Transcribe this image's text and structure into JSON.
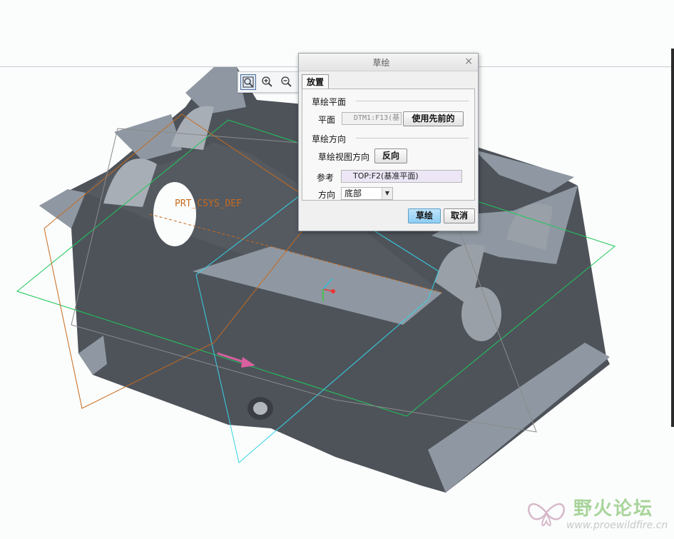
{
  "viewport": {
    "csys_label": "PRT_CSYS_DEF",
    "colors": {
      "part": "#4e535a",
      "part_top": "#8f98a2",
      "datum_green": "#1ec85a",
      "datum_cyan": "#35d3e6",
      "datum_orange": "#c76a1c",
      "arrow": "#d9609f"
    }
  },
  "view_toolbar": {
    "buttons": [
      {
        "icon": "refit-icon"
      },
      {
        "icon": "zoom-in-icon"
      },
      {
        "icon": "zoom-out-icon"
      }
    ]
  },
  "dialog": {
    "title": "草绘",
    "close_glyph": "×",
    "tab_label": "放置",
    "plane_section": "草绘平面",
    "plane_label": "平面",
    "plane_value": "DTM1:F13(基",
    "use_previous_button": "使用先前的",
    "orientation_section": "草绘方向",
    "view_dir_label": "草绘视图方向",
    "flip_button": "反向",
    "reference_label": "参考",
    "reference_value": "TOP:F2(基准平面)",
    "direction_label": "方向",
    "direction_value": "底部",
    "sketch_button": "草绘",
    "cancel_button": "取消"
  },
  "watermark": {
    "title": "野火论坛",
    "url": "www.proewildfire.cn"
  }
}
